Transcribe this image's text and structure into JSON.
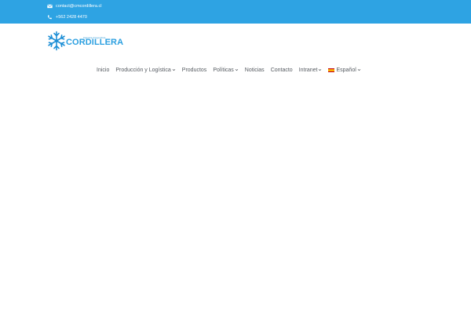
{
  "topbar": {
    "email": "contact@cmcordillera.cl",
    "phone": "+562 2428 4470",
    "background": "#2ea3e3"
  },
  "logo": {
    "sup": "Cámara Frigorífica",
    "name": "CORDILLERA",
    "icon": "snowflake-icon",
    "color": "#2b9fe0"
  },
  "nav": {
    "items": [
      {
        "label": "Inicio",
        "dropdown": false
      },
      {
        "label": "Producción y Logística",
        "dropdown": true
      },
      {
        "label": "Productos",
        "dropdown": false
      },
      {
        "label": "Políticas",
        "dropdown": true
      },
      {
        "label": "Noticias",
        "dropdown": false
      },
      {
        "label": "Contacto",
        "dropdown": false
      },
      {
        "label": "Intranet",
        "dropdown": true
      },
      {
        "label": "Español",
        "dropdown": true,
        "icon": "spain-flag-icon"
      }
    ]
  }
}
